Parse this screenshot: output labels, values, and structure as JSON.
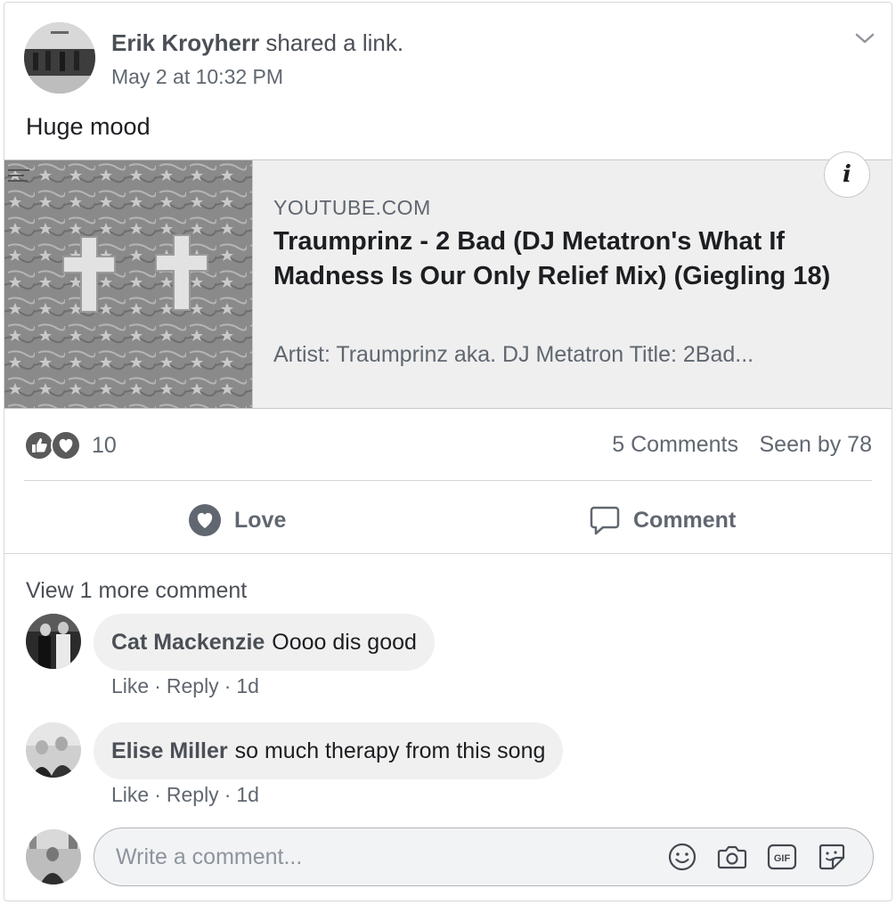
{
  "post": {
    "author": "Erik Kroyherr",
    "action": "shared a link.",
    "timestamp": "May 2 at 10:32 PM",
    "text": "Huge mood"
  },
  "link": {
    "domain": "YOUTUBE.COM",
    "title": "Traumprinz - 2 Bad (DJ Metatron's What If Madness Is Our Only Relief Mix) (Giegling 18)",
    "description": "Artist: Traumprinz aka. DJ Metatron Title: 2Bad...",
    "info_icon": "i"
  },
  "stats": {
    "reaction_count": "10",
    "comments": "5 Comments",
    "seen_by": "Seen by 78"
  },
  "actions": {
    "love_label": "Love",
    "comment_label": "Comment"
  },
  "comments": {
    "view_more": "View 1 more comment",
    "items": [
      {
        "author": "Cat Mackenzie",
        "text": "Oooo dis good",
        "like": "Like",
        "reply": "Reply",
        "time": "1d"
      },
      {
        "author": "Elise Miller",
        "text": "so much therapy from this song",
        "like": "Like",
        "reply": "Reply",
        "time": "1d"
      }
    ],
    "separator": "·"
  },
  "composer": {
    "placeholder": "Write a comment..."
  },
  "icons": {
    "like_reaction": "thumbs-up-icon",
    "love_reaction": "heart-icon",
    "emoji": "smiley-icon",
    "camera": "camera-icon",
    "gif": "gif-icon",
    "sticker": "sticker-icon"
  }
}
